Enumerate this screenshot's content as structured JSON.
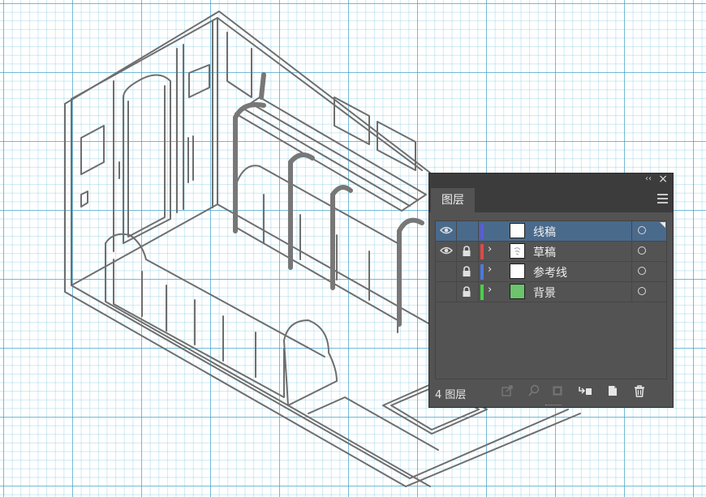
{
  "panel": {
    "tab_label": "图层",
    "collapse_glyph": "‹‹",
    "close_glyph": "×",
    "menu_icon": "hamburger-menu-icon",
    "layer_count_text": "4 图层",
    "footer_icons": [
      "export-icon",
      "search-icon",
      "clipping-mask-icon",
      "sublayer-icon",
      "new-layer-icon",
      "delete-icon"
    ],
    "colors": {
      "background": "#535353",
      "titlebar": "#3c3c3c",
      "selection": "#4a6a8c"
    }
  },
  "layers": [
    {
      "name": "线稿",
      "visible": true,
      "locked": false,
      "expandable": false,
      "color": "#5b5bdc",
      "selected": true,
      "thumb": "blank"
    },
    {
      "name": "草稿",
      "visible": true,
      "locked": true,
      "expandable": true,
      "color": "#e04848",
      "selected": false,
      "thumb": "sketch"
    },
    {
      "name": "参考线",
      "visible": false,
      "locked": true,
      "expandable": true,
      "color": "#4a7ae0",
      "selected": false,
      "thumb": "blank"
    },
    {
      "name": "背景",
      "visible": false,
      "locked": true,
      "expandable": true,
      "color": "#48d048",
      "selected": false,
      "thumb": "green"
    }
  ]
}
